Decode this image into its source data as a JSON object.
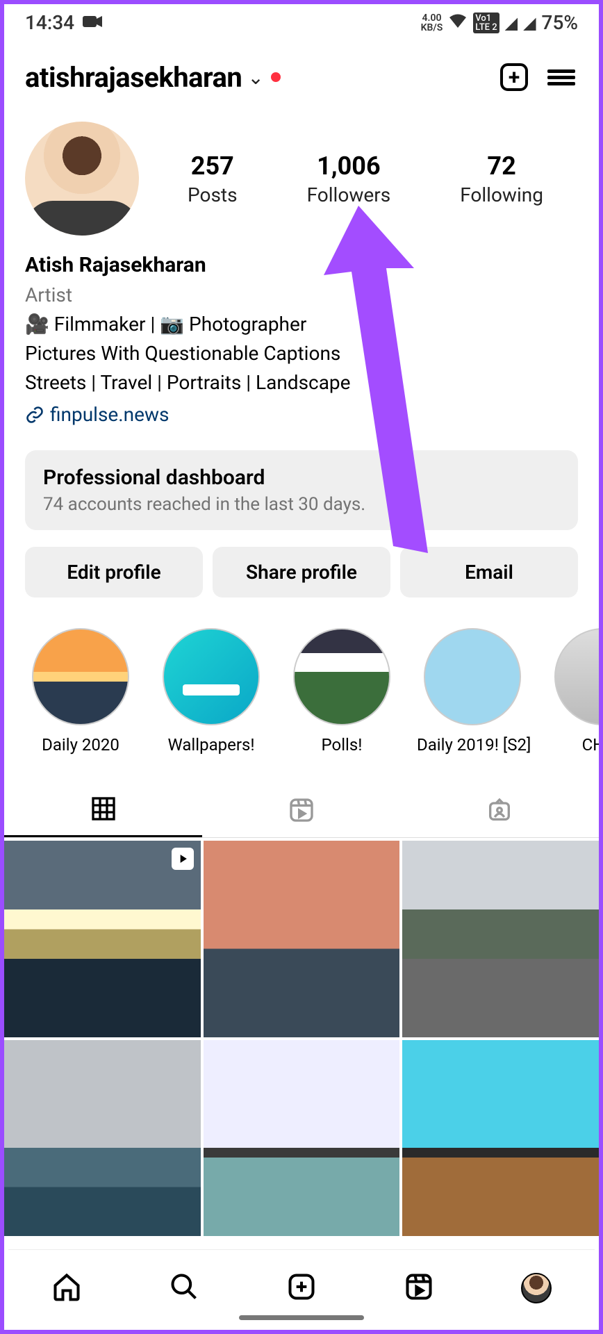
{
  "status": {
    "time": "14:34",
    "data_rate_top": "4.00",
    "data_rate_bottom": "KB/S",
    "lte": "LTE 2",
    "volte": "Vo1",
    "battery": "75%"
  },
  "header": {
    "username": "atishrajasekharan"
  },
  "stats": {
    "posts_count": "257",
    "posts_label": "Posts",
    "followers_count": "1,006",
    "followers_label": "Followers",
    "following_count": "72",
    "following_label": "Following"
  },
  "bio": {
    "display_name": "Atish Rajasekharan",
    "category": "Artist",
    "line1": "🎥 Filmmaker | 📷 Photographer",
    "line2": "Pictures With Questionable Captions",
    "line3": "Streets | Travel | Portraits | Landscape",
    "link": "finpulse.news"
  },
  "dashboard": {
    "title": "Professional dashboard",
    "subtitle": "74 accounts reached in the last 30 days."
  },
  "buttons": {
    "edit": "Edit profile",
    "share": "Share profile",
    "email": "Email"
  },
  "highlights": {
    "h1": "Daily 2020",
    "h2": "Wallpapers!",
    "h3": "Polls!",
    "h4": "Daily 2019! [S2]",
    "h5": "CHIKI"
  }
}
